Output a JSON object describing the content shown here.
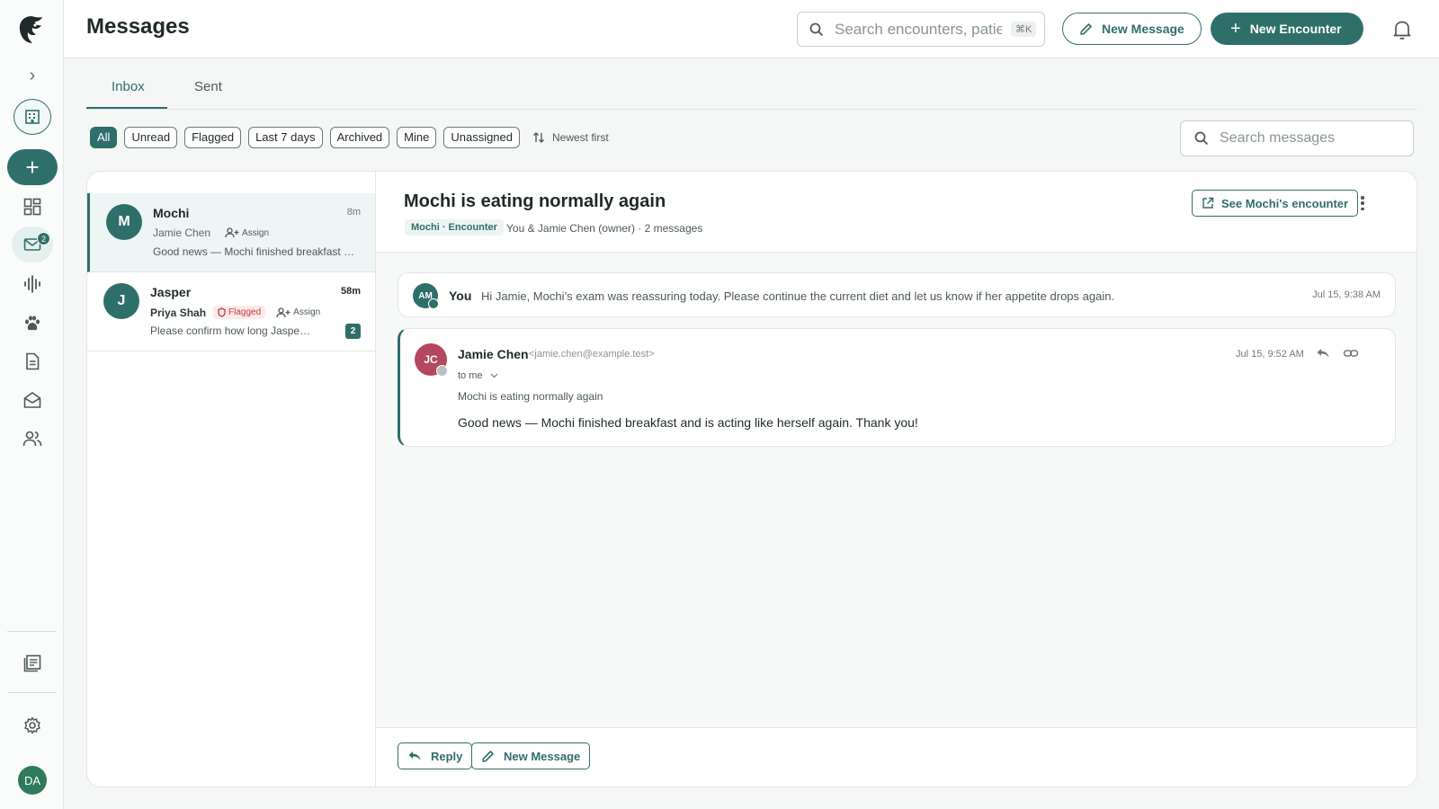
{
  "sidebar": {
    "badge_count": "2",
    "avatar_initials": "DA",
    "new_label": "+"
  },
  "header": {
    "title": "Messages",
    "search_placeholder": "Search encounters, patients",
    "search_shortcut": "⌘K",
    "new_message_label": "New Message",
    "new_encounter_label": "New Encounter"
  },
  "tabs": [
    {
      "label": "Inbox",
      "active": true
    },
    {
      "label": "Sent",
      "active": false
    }
  ],
  "filters": [
    {
      "label": "All",
      "active": true
    },
    {
      "label": "Unread",
      "active": false
    },
    {
      "label": "Flagged",
      "active": false
    },
    {
      "label": "Last 7 days",
      "active": false
    },
    {
      "label": "Archived",
      "active": false
    },
    {
      "label": "Mine",
      "active": false
    },
    {
      "label": "Unassigned",
      "active": false
    }
  ],
  "sort_label": "Newest first",
  "message_search_placeholder": "Search messages",
  "conversations": [
    {
      "initial": "M",
      "name": "Mochi",
      "time": "8m",
      "owner": "Jamie Chen",
      "assign_label": "Assign",
      "preview": "Good news — Mochi finished breakfast and is acting like herself again. Thank you!"
    },
    {
      "initial": "J",
      "name": "Jasper",
      "time": "58m",
      "owner": "Priya Shah",
      "flag_label": "Flagged",
      "assign_label": "Assign",
      "preview": "Please confirm how long Jasper should stay on the medication.",
      "count": "2"
    }
  ],
  "thread": {
    "title": "Mochi is eating normally again",
    "tag": "Mochi · Encounter",
    "meta": "You & Jamie Chen (owner) · 2 messages",
    "see_encounter_label": "See Mochi's encounter",
    "messages": [
      {
        "avatar": "AM",
        "sender": "You",
        "text": "Hi Jamie, Mochi’s exam was reassuring today. Please continue the current diet and let us know if her appetite drops again.",
        "time": "Jul 15, 9:38 AM"
      },
      {
        "avatar": "JC",
        "sender": "Jamie Chen",
        "email": "<jamie.chen@example.test>",
        "to": "to me",
        "subject": "Mochi is eating normally again",
        "text": "Good news — Mochi finished breakfast and is acting like herself again. Thank you!",
        "time": "Jul 15, 9:52 AM"
      }
    ],
    "reply_label": "Reply",
    "new_message_label": "New Message"
  },
  "colors": {
    "accent": "#2f6f6a",
    "flag": "#c23b3b",
    "avatar_jc": "#b5475f"
  }
}
